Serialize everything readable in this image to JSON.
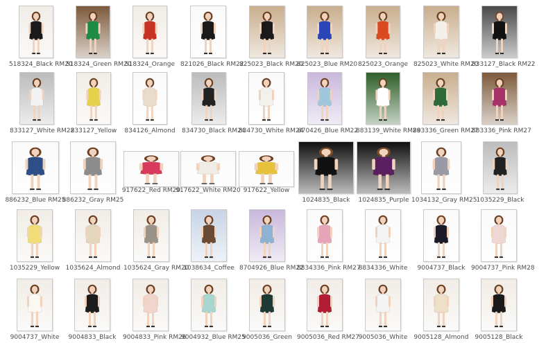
{
  "thumbnails": [
    {
      "label": "518324_Black RM20",
      "tone": "light",
      "dress": "#1a1a1a"
    },
    {
      "label": "518324_Green RM20",
      "tone": "brown",
      "dress": "#1d8a45"
    },
    {
      "label": "518324_Orange",
      "tone": "light",
      "dress": "#c83224"
    },
    {
      "label": "821026_Black RM22",
      "tone": "white",
      "dress": "#1a1a1a"
    },
    {
      "label": "825023_Black RM20",
      "tone": "tan",
      "dress": "#1a1a1a"
    },
    {
      "label": "825023_Blue RM20",
      "tone": "tan",
      "dress": "#2a45b8"
    },
    {
      "label": "825023_Orange",
      "tone": "tan",
      "dress": "#d94a20"
    },
    {
      "label": "825023_White RM20",
      "tone": "tan",
      "dress": "#f3f0ea"
    },
    {
      "label": "833127_Black RM22",
      "tone": "dark",
      "dress": "#111111"
    },
    {
      "label": "833127_White RM22",
      "tone": "gray",
      "dress": "#f2f2f2"
    },
    {
      "label": "833127_Yellow",
      "tone": "light",
      "dress": "#e6d24a"
    },
    {
      "label": "834126_Almond",
      "tone": "white",
      "dress": "#e9dccb"
    },
    {
      "label": "834730_Black RM24",
      "tone": "gray",
      "dress": "#222222"
    },
    {
      "label": "834730_White RM24",
      "tone": "white",
      "dress": "#f3f1ec"
    },
    {
      "label": "870426_Blue RM22",
      "tone": "violet",
      "dress": "#9fc6dc"
    },
    {
      "label": "883139_White RM29",
      "tone": "green",
      "dress": "#ffffff"
    },
    {
      "label": "883336_Green RM27",
      "tone": "tan",
      "dress": "#2f6b3a"
    },
    {
      "label": "883336_Pink RM27",
      "tone": "brown",
      "dress": "#a8326a"
    },
    {
      "label": "886232_Blue RM25",
      "tone": "white",
      "dress": "#2d4e86"
    },
    {
      "label": "886232_Gray RM25",
      "tone": "white",
      "dress": "#8d8d8d"
    },
    {
      "label": "917622_Red RM20",
      "tone": "white",
      "dress": "#d83a5c"
    },
    {
      "label": "917622_White RM20",
      "tone": "white",
      "dress": "#efece6"
    },
    {
      "label": "917622_Yellow",
      "tone": "white",
      "dress": "#e7c23d"
    },
    {
      "label": "1024835_Black",
      "tone": "black",
      "dress": "#111111"
    },
    {
      "label": "1024835_Purple",
      "tone": "black",
      "dress": "#5a1f5e"
    },
    {
      "label": "1034132_Gray RM25",
      "tone": "white",
      "dress": "#9a9aa6"
    },
    {
      "label": "1035229_Black",
      "tone": "gray",
      "dress": "#222222"
    },
    {
      "label": "1035229_Yellow",
      "tone": "light",
      "dress": "#f0dd78"
    },
    {
      "label": "1035624_Almond",
      "tone": "light",
      "dress": "#e4d5bd"
    },
    {
      "label": "1035624_Gray RM20",
      "tone": "light",
      "dress": "#9b9389"
    },
    {
      "label": "1038634_Coffee",
      "tone": "blue",
      "dress": "#6a4a35"
    },
    {
      "label": "8704926_Blue RM22",
      "tone": "violet",
      "dress": "#8fb2d2"
    },
    {
      "label": "8834336_Pink RM27",
      "tone": "white",
      "dress": "#e7a3b7"
    },
    {
      "label": "8834336_White",
      "tone": "white",
      "dress": "#f4f4f4"
    },
    {
      "label": "9004737_Black",
      "tone": "white",
      "dress": "#1a1a2a"
    },
    {
      "label": "9004737_Pink RM28",
      "tone": "white",
      "dress": "#efd8d4"
    },
    {
      "label": "9004737_White",
      "tone": "light",
      "dress": "#fbf8f2"
    },
    {
      "label": "9004833_Black",
      "tone": "light",
      "dress": "#1c1c1c"
    },
    {
      "label": "9004833_Pink RM26",
      "tone": "light",
      "dress": "#f1d5cd"
    },
    {
      "label": "9004932_Blue RM25",
      "tone": "light",
      "dress": "#a9d5cf"
    },
    {
      "label": "9005036_Green",
      "tone": "light",
      "dress": "#1f3a34"
    },
    {
      "label": "9005036_Red RM27",
      "tone": "light",
      "dress": "#b01d35"
    },
    {
      "label": "9005036_White",
      "tone": "light",
      "dress": "#f4f4f4"
    },
    {
      "label": "9005128_Almond",
      "tone": "light",
      "dress": "#eee0c8"
    },
    {
      "label": "9005128_Black",
      "tone": "light",
      "dress": "#1a1a1a"
    }
  ],
  "colors": {
    "label_text": "#4d4d4d",
    "thumb_border": "#c9c9c9",
    "tones": {
      "light": "#f1ece6",
      "white": "#fafafa",
      "tan": "#c9ae8e",
      "brown": "#7d5a3c",
      "dark": "#4a4a4a",
      "gray": "#bcbcbc",
      "violet": "#c9b8dc",
      "green": "#2f5f2a",
      "black": "#101010",
      "blue": "#c7d4e6"
    }
  }
}
